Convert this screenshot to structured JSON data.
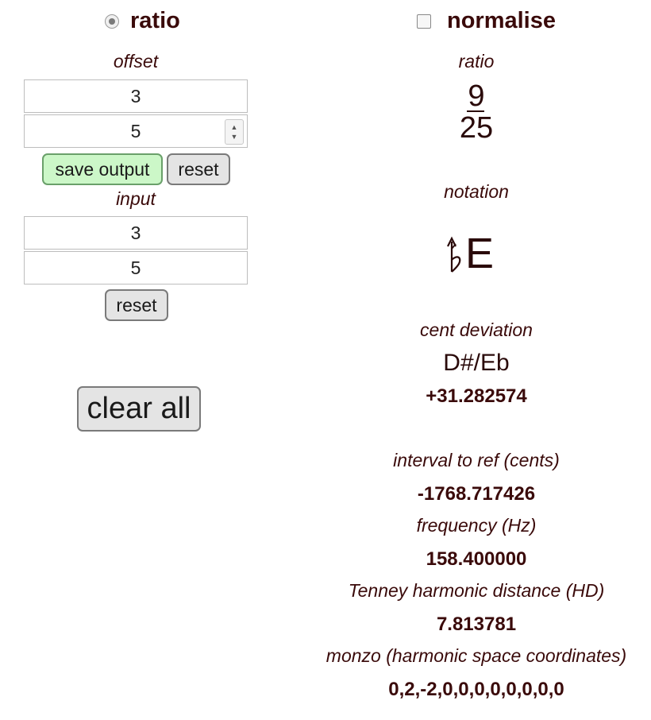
{
  "mode_left": {
    "label": "ratio",
    "selected": true
  },
  "mode_right": {
    "label": "normalise",
    "checked": false
  },
  "offset": {
    "label": "offset",
    "numerator": "3",
    "denominator": "5",
    "save_label": "save output",
    "reset_label": "reset"
  },
  "input": {
    "label": "input",
    "numerator": "3",
    "denominator": "5",
    "reset_label": "reset"
  },
  "clear_all_label": "clear all",
  "result": {
    "ratio_label": "ratio",
    "ratio_numerator": "9",
    "ratio_denominator": "25",
    "notation_label": "notation",
    "notation_letter": "E",
    "notation_accidental": "arrow-up-flat",
    "cent_deviation_label": "cent deviation",
    "nearest_note": "D#/Eb",
    "cent_deviation": "+31.282574",
    "interval_label": "interval to ref (cents)",
    "interval": "-1768.717426",
    "frequency_label": "frequency (Hz)",
    "frequency": "158.400000",
    "tenney_label": "Tenney harmonic distance (HD)",
    "tenney": "7.813781",
    "monzo_label": "monzo (harmonic space coordinates)",
    "monzo": "0,2,-2,0,0,0,0,0,0,0,0"
  }
}
